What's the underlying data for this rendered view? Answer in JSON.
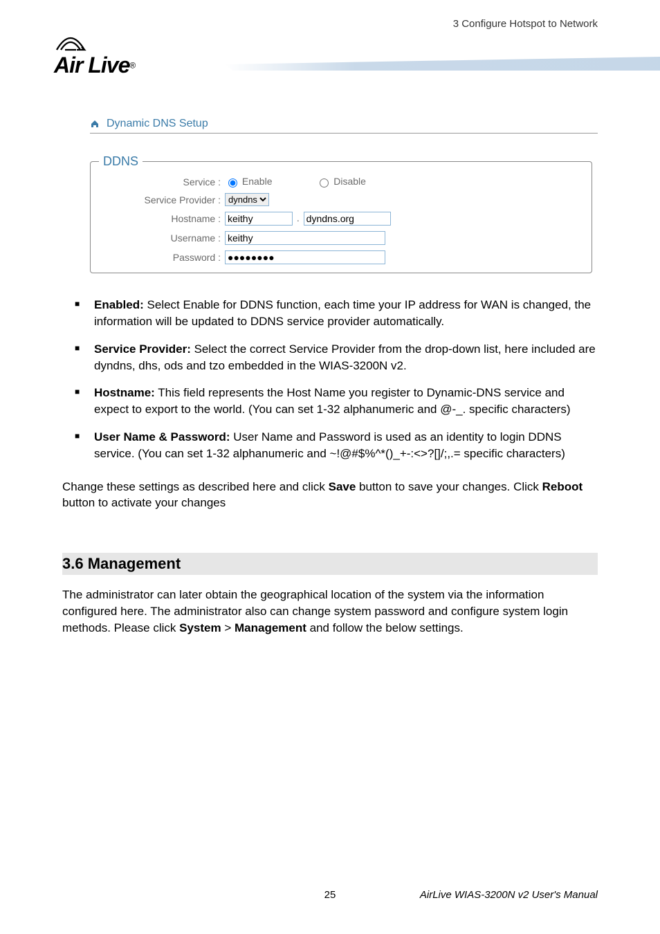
{
  "header": {
    "chapter": "3  Configure  Hotspot  to  Network"
  },
  "logo": {
    "brand_pre": "A",
    "brand_mid": "ir Live",
    "reg": "®"
  },
  "setup": {
    "title": "Dynamic DNS Setup",
    "legend": "DDNS",
    "labels": {
      "service": "Service :",
      "provider": "Service Provider :",
      "hostname": "Hostname :",
      "username": "Username :",
      "password": "Password :"
    },
    "radio_enable": "Enable",
    "radio_disable": "Disable",
    "provider_value": "dyndns",
    "hostname_value": "keithy",
    "hostname_suffix": "dyndns.org",
    "username_value": "keithy",
    "password_value": "●●●●●●●●"
  },
  "bullets": {
    "enabled_title": "Enabled:",
    "enabled_body": " Select Enable for DDNS function, each time your IP address for WAN is changed, the information will be updated to DDNS service provider automatically.",
    "service_title": "Service Provider:",
    "service_body": " Select the correct Service Provider from the drop-down list, here included are dyndns, dhs, ods and tzo embedded in the WIAS-3200N v2.",
    "host_title": "Hostname:",
    "host_body": " This field represents the Host Name you register to Dynamic-DNS service and expect to export to the world. (You can set 1-32 alphanumeric and @-_. specific characters)",
    "user_title": "User Name & Password:",
    "user_body": " User Name and Password is used as an identity to login DDNS service. (You can set 1-32 alphanumeric and ~!@#$%^*()_+-:<>?[]/;,.= specific characters)"
  },
  "save_para_1": "Change these settings as described here and click ",
  "save_bold": "Save",
  "save_para_2": " button to save your changes. Click ",
  "reboot_bold": "Reboot",
  "save_para_3": " button to activate your changes",
  "section": {
    "heading": "3.6  Management",
    "text_1": "The administrator can later obtain the geographical location of the system via the information configured here. The administrator also can change system password and configure system login methods. Please click ",
    "bold_system": "System",
    "text_gt": " > ",
    "bold_mgmt": "Management",
    "text_2": " and follow the below settings."
  },
  "footer": {
    "page": "25",
    "manual": "AirLive WIAS-3200N v2 User's Manual"
  }
}
